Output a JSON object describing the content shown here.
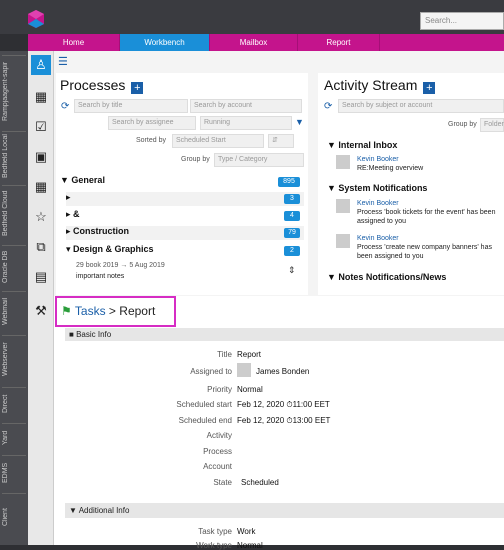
{
  "topbar": {
    "search_placeholder": "Search..."
  },
  "nav": {
    "tabs": [
      "Home",
      "Workbench",
      "Mailbox",
      "Report"
    ],
    "active": "Workbench"
  },
  "left_tabs": [
    "Rampjaagent-sapir",
    "Bedfield Local",
    "Bedfield Cloud",
    "Oracle DB",
    "Webmail",
    "Webserver",
    "Direct",
    "Yard",
    "EDMS",
    "Client"
  ],
  "processes": {
    "title": "Processes",
    "search_title_placeholder": "Search by title",
    "search_account_placeholder": "Search by account",
    "assignee_placeholder": "Search by assignee",
    "status_value": "Running",
    "sorted_by_label": "Sorted by",
    "sorted_by_value": "Scheduled Start",
    "group_by_label": "Group by",
    "group_by_value": "Type / Category",
    "groups": [
      {
        "name": "General",
        "count": "895"
      },
      {
        "name": "",
        "count": "3"
      },
      {
        "name": "&",
        "count": "4"
      },
      {
        "name": "Construction",
        "count": "79"
      },
      {
        "name": "Design & Graphics",
        "count": "2"
      }
    ],
    "item_dates": "29 book 2019  → 5 Aug 2019",
    "item_title": "important notes"
  },
  "activity": {
    "title": "Activity Stream",
    "search_placeholder": "Search by subject or account",
    "group_by_label": "Group by",
    "group_by_value": "Folder",
    "sections": [
      "Internal Inbox",
      "System Notifications",
      "Notes Notifications/News"
    ],
    "items": [
      {
        "who": "Kevin Booker",
        "text": "RE:Meeting overview"
      },
      {
        "who": "Kevin Booker",
        "text": "Process 'book tickets for the event' has been assigned to you"
      },
      {
        "who": "Kevin Booker",
        "text": "Process 'create new company banners' has been assigned to you"
      }
    ]
  },
  "detail": {
    "crumb_root": "Tasks",
    "crumb_sep": ">",
    "crumb_current": "Report",
    "basic_info": "Basic Info",
    "additional_info": "Additional Info",
    "fields": [
      {
        "label": "Title",
        "value": "Report"
      },
      {
        "label": "Assigned to",
        "value": "James Bonden"
      },
      {
        "label": "Priority",
        "value": "Normal"
      },
      {
        "label": "Scheduled start",
        "value": "Feb 12, 2020 ⏱11:00 EET"
      },
      {
        "label": "Scheduled end",
        "value": "Feb 12, 2020 ⏱13:00 EET"
      },
      {
        "label": "Activity",
        "value": ""
      },
      {
        "label": "Process",
        "value": ""
      },
      {
        "label": "Account",
        "value": ""
      },
      {
        "label": "State",
        "value": "Scheduled"
      }
    ],
    "additional_fields": [
      {
        "label": "Task type",
        "value": "Work"
      },
      {
        "label": "Work type",
        "value": "Normal"
      }
    ]
  }
}
